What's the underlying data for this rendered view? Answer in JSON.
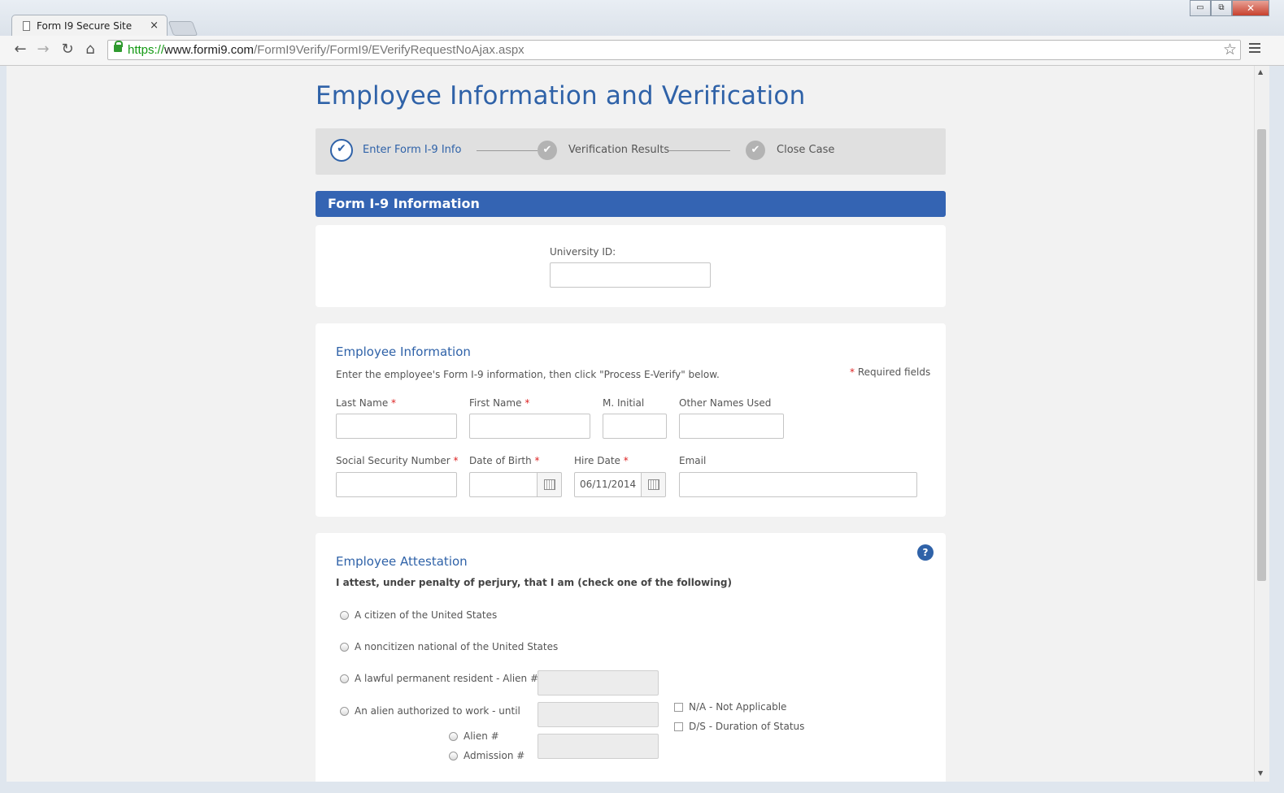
{
  "browser": {
    "tab_title": "Form I9 Secure Site",
    "tab_close": "×",
    "url_scheme": "https://",
    "url_host": "www.formi9.com",
    "url_path": "/FormI9Verify/FormI9/EVerifyRequestNoAjax.aspx",
    "win_min": "▭",
    "win_max": "⧉",
    "win_close": "✕"
  },
  "page": {
    "title": "Employee Information and Verification"
  },
  "steps": [
    {
      "label": "Enter Form I-9 Info",
      "state": "active"
    },
    {
      "label": "Verification Results",
      "state": "pending"
    },
    {
      "label": "Close Case",
      "state": "pending"
    }
  ],
  "section_header": "Form I-9 Information",
  "university": {
    "label": "University ID:",
    "value": ""
  },
  "employee_info": {
    "heading": "Employee Information",
    "instructions": "Enter the employee's Form I-9 information, then click \"Process E-Verify\" below.",
    "required_star": "*",
    "required_note": "Required fields",
    "fields": {
      "last_name": {
        "label": "Last Name",
        "value": ""
      },
      "first_name": {
        "label": "First Name",
        "value": ""
      },
      "middle_initial": {
        "label": "M. Initial",
        "value": ""
      },
      "other_names": {
        "label": "Other Names Used",
        "value": ""
      },
      "ssn": {
        "label": "Social Security Number",
        "value": ""
      },
      "dob": {
        "label": "Date of Birth",
        "value": ""
      },
      "hire_date": {
        "label": "Hire Date",
        "value": "06/11/2014"
      },
      "email": {
        "label": "Email",
        "value": ""
      }
    }
  },
  "attestation": {
    "heading": "Employee Attestation",
    "help": "?",
    "statement": "I attest, under penalty of perjury, that I am (check one of the following)",
    "options": [
      {
        "label": "A citizen of the United States"
      },
      {
        "label": "A noncitizen national of the United States"
      },
      {
        "label": "A lawful permanent resident - Alien #"
      },
      {
        "label": "An alien authorized to work - until"
      }
    ],
    "sub_options": [
      {
        "label": "Alien #"
      },
      {
        "label": "Admission #"
      }
    ],
    "checkboxes": [
      {
        "label": "N/A - Not Applicable"
      },
      {
        "label": "D/S - Duration of Status"
      }
    ]
  }
}
